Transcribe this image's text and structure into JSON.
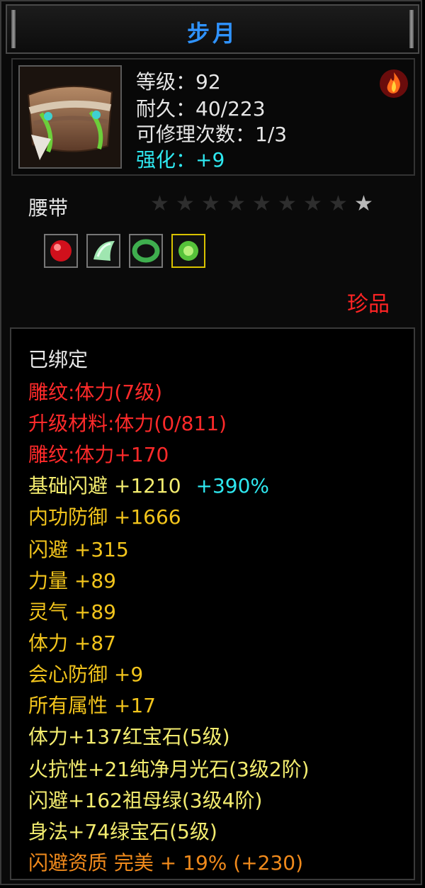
{
  "window": {
    "title": "步月"
  },
  "item": {
    "level_text": "等级：92",
    "durability_text": "耐久：40/223",
    "repair_text": "可修理次数：1/3",
    "enhance_text": "强化：+9",
    "type": "腰带",
    "rarity": "珍品",
    "stars": {
      "total": 9,
      "lit": 1
    },
    "element_icon": "fire-element-icon"
  },
  "gems": [
    {
      "name": "ruby-gem-icon",
      "color": "#e0202a"
    },
    {
      "name": "moonstone-gem-icon",
      "color": "#8fe0a0"
    },
    {
      "name": "emerald-gem-icon",
      "color": "#3fae4e"
    },
    {
      "name": "green-gem-icon",
      "color": "#6fd040"
    }
  ],
  "attributes": {
    "bound": "已绑定",
    "engrave": "雕纹:体力(7级)",
    "upgrade_material": "升级材料:体力(0/811)",
    "engrave_bonus": "雕纹:体力+170",
    "base_dodge": "基础闪避 +1210",
    "base_dodge_pct": "+390%",
    "internal_def": "内功防御 +1666",
    "dodge": "闪避 +315",
    "strength": "力量 +89",
    "spirit": "灵气 +89",
    "stamina": "体力 +87",
    "crit_def": "会心防御 +9",
    "all_attr": "所有属性 +17",
    "gem1": "体力+137红宝石(5级)",
    "gem2": "火抗性+21纯净月光石(3级2阶)",
    "gem3": "闪避+162祖母绿(3级4阶)",
    "gem4": "身法+74绿宝石(5级)",
    "quality": "闪避资质 完美 + 19% (+230)"
  }
}
